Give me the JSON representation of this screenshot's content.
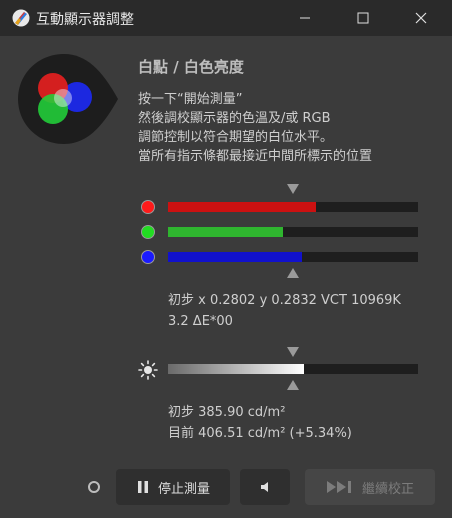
{
  "window": {
    "title": "互動顯示器調整",
    "icon": "display-calibration-app-icon",
    "controls": [
      "minimize-icon",
      "maximize-icon",
      "close-icon"
    ]
  },
  "section": {
    "heading": "白點 / 白色亮度",
    "instructions": [
      "按一下“開始測量”",
      "然後調校顯示器的色溫及/或 RGB",
      "調節控制以符合期望的白位水平。",
      "當所有指示條都最接近中間所標示的位置"
    ]
  },
  "rgb_bars": [
    {
      "name": "red",
      "color": "#cc1111",
      "dot_color": "#ff1a1a",
      "level": 0.59
    },
    {
      "name": "green",
      "color": "#2fb52f",
      "dot_color": "#22dd22",
      "level": 0.46
    },
    {
      "name": "blue",
      "color": "#1111cc",
      "dot_color": "#1a1aff",
      "level": 0.535
    }
  ],
  "rgb_target_level": 0.5,
  "readings": {
    "initial_chromaticity": "初步 x 0.2802 y 0.2832 VCT 10969K",
    "delta_e": "3.2 ΔE*00"
  },
  "brightness": {
    "icon": "sun-icon",
    "level": 0.545,
    "target_level": 0.5,
    "initial": "初步 385.90 cd/m²",
    "current": "目前 406.51 cd/m² (+5.34%)"
  },
  "footer": {
    "status_icon": "status-ring-icon",
    "stop_button": {
      "icon": "pause-icon",
      "label": "停止測量"
    },
    "sound_button": {
      "icon": "speaker-icon"
    },
    "continue_button": {
      "icon": "skip-forward-icon",
      "label": "繼續校正",
      "enabled": false
    }
  }
}
